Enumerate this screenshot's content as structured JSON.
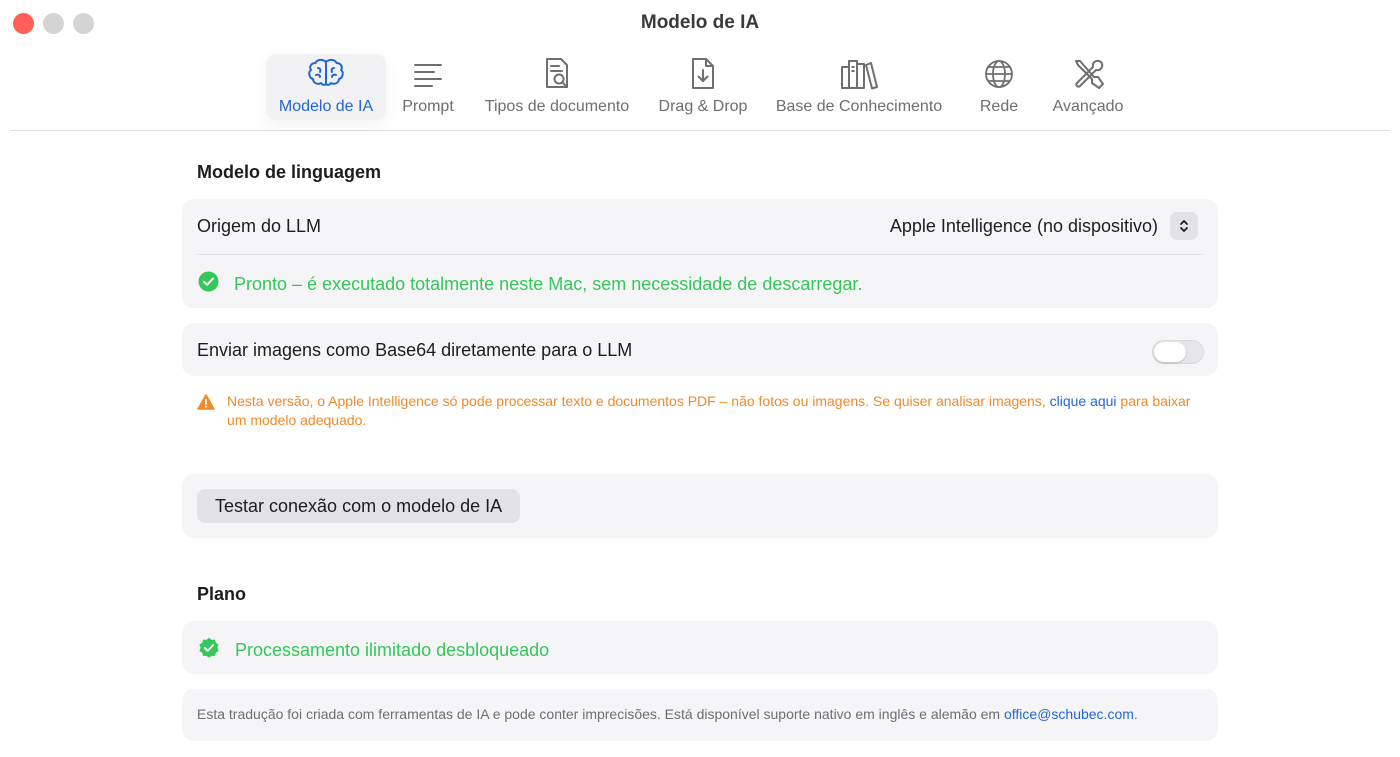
{
  "window": {
    "title": "Modelo de IA"
  },
  "toolbar": {
    "tabs": [
      {
        "label": "Modelo de IA",
        "icon": "brain-icon",
        "active": true
      },
      {
        "label": "Prompt",
        "icon": "text-lines-icon"
      },
      {
        "label": "Tipos de documento",
        "icon": "document-search-icon"
      },
      {
        "label": "Drag & Drop",
        "icon": "document-download-icon"
      },
      {
        "label": "Base de Conhecimento",
        "icon": "books-icon"
      },
      {
        "label": "Rede",
        "icon": "globe-icon"
      },
      {
        "label": "Avançado",
        "icon": "tools-icon"
      }
    ]
  },
  "language_model": {
    "section_title": "Modelo de linguagem",
    "llm_source_label": "Origem do LLM",
    "llm_source_value": "Apple Intelligence (no dispositivo)",
    "status_text": "Pronto – é executado totalmente neste Mac, sem necessidade de descarregar.",
    "base64_label": "Enviar imagens como Base64 diretamente para o LLM",
    "base64_enabled": false,
    "warning_text": "Nesta versão, o Apple Intelligence só pode processar texto e documentos PDF – não fotos ou imagens. Se quiser analisar imagens, ",
    "warning_link": "clique aqui",
    "warning_suffix": " para baixar um modelo adequado.",
    "test_button": "Testar conexão com o modelo de IA"
  },
  "plan": {
    "section_title": "Plano",
    "status_text": "Processamento ilimitado desbloqueado"
  },
  "footer_note": {
    "text": "Esta tradução foi criada com ferramentas de IA e pode conter imprecisões. Está disponível suporte nativo em inglês e alemão em ",
    "email": "office@schubec.com",
    "suffix": "."
  },
  "colors": {
    "accent": "#2166d8",
    "success": "#34c759",
    "warning": "#ee8a2a",
    "close": "#ff5f57"
  }
}
